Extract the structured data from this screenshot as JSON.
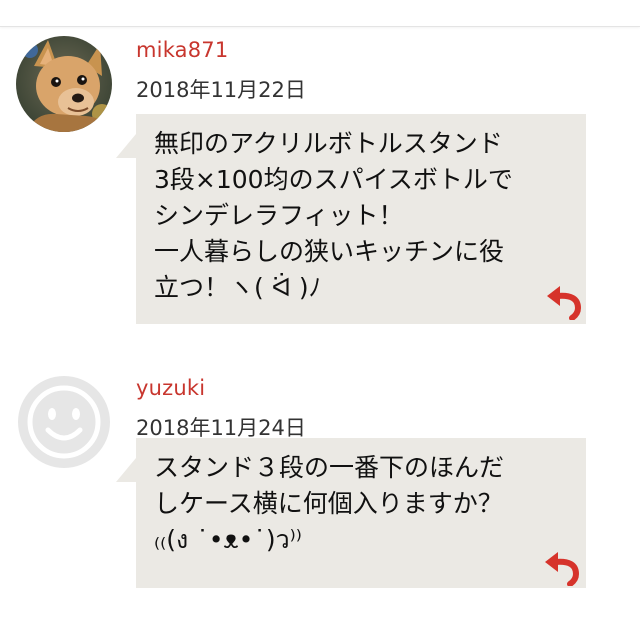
{
  "comments": [
    {
      "username": "mika871",
      "date": "2018年11月22日",
      "avatar_icon": "dog-photo-avatar",
      "lines": [
        "無印のアクリルボトルスタンド",
        "3段×100均のスパイスボトルで",
        "シンデレラフィット！",
        "一人暮らしの狭いキッチンに役",
        "立つ！ヽ( ᐛ )ﾉ"
      ],
      "reply_icon": "reply-arrow-icon"
    },
    {
      "username": "yuzuki",
      "date": "2018年11月24日",
      "avatar_icon": "smiley-face-avatar",
      "lines": [
        "スタンド３段の一番下のほんだ",
        "しケース横に何個入りますか？",
        "₍₍(ง ˙•ᴥ•˙)ว⁾⁾"
      ],
      "reply_icon": "reply-arrow-icon"
    }
  ],
  "colors": {
    "username": "#c8362e",
    "bubble": "#ebe9e4",
    "reply_icon": "#d6332b",
    "default_avatar": "#e6e6e6"
  }
}
